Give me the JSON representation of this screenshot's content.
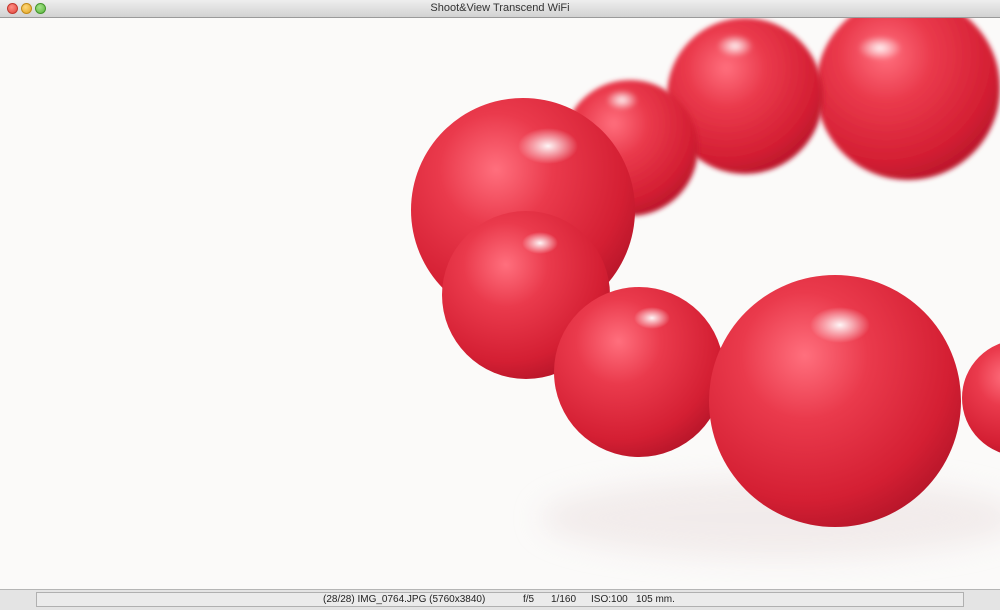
{
  "window": {
    "title": "Shoot&View Transcend WiFi"
  },
  "viewer": {
    "photo_subject": "red-coral-bead-bracelet",
    "background_color": "#fafafa",
    "bead_color": "#e0283a"
  },
  "status": {
    "image_info": "(28/28) IMG_0764.JPG (5760x3840)",
    "aperture": "f/5",
    "shutter": "1/160",
    "iso": "ISO:100",
    "focal_length": "105 mm."
  }
}
